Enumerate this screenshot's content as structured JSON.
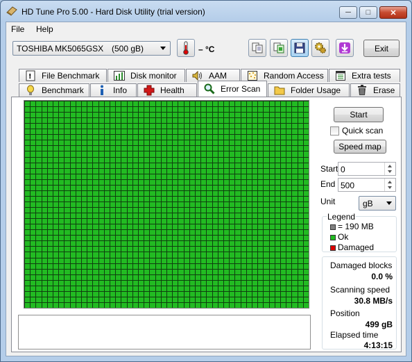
{
  "window": {
    "title": "HD Tune Pro 5.00 - Hard Disk Utility (trial version)",
    "controls": {
      "minimize": "─",
      "maximize": "□",
      "close": "✕"
    }
  },
  "menu": [
    {
      "label": "File"
    },
    {
      "label": "Help"
    }
  ],
  "toolbar": {
    "drive_name": "TOSHIBA MK5065GSX",
    "drive_size": "(500 gB)",
    "temperature": "– °C",
    "exit_label": "Exit"
  },
  "tabs_top": [
    {
      "label": "File Benchmark",
      "icon": "file-benchmark-icon"
    },
    {
      "label": "Disk monitor",
      "icon": "disk-monitor-icon"
    },
    {
      "label": "AAM",
      "icon": "speaker-icon"
    },
    {
      "label": "Random Access",
      "icon": "random-access-icon"
    },
    {
      "label": "Extra tests",
      "icon": "extra-tests-icon"
    }
  ],
  "tabs_bottom": [
    {
      "label": "Benchmark",
      "icon": "benchmark-icon"
    },
    {
      "label": "Info",
      "icon": "info-icon"
    },
    {
      "label": "Health",
      "icon": "health-cross-icon"
    },
    {
      "label": "Error Scan",
      "icon": "magnifier-icon",
      "selected": true
    },
    {
      "label": "Folder Usage",
      "icon": "folder-icon"
    },
    {
      "label": "Erase",
      "icon": "trash-icon"
    }
  ],
  "error_scan": {
    "start_button": "Start",
    "quick_scan_label": "Quick scan",
    "quick_scan_checked": false,
    "speed_map_button": "Speed map",
    "start_label": "Start",
    "start_value": "0",
    "end_label": "End",
    "end_value": "500",
    "unit_label": "Unit",
    "unit_value": "gB",
    "block_status": "ok",
    "colors": {
      "ok": "#22bb22",
      "damaged": "#dd0000",
      "block": "#808080",
      "grid": "#0f3f0f"
    }
  },
  "legend": {
    "title": "Legend",
    "items": [
      {
        "label": "= 190 MB",
        "color": "#808080"
      },
      {
        "label": "Ok",
        "color": "#22bb22"
      },
      {
        "label": "Damaged",
        "color": "#dd0000"
      }
    ]
  },
  "stats": {
    "damaged_blocks_label": "Damaged blocks",
    "damaged_blocks_value": "0.0 %",
    "scanning_speed_label": "Scanning speed",
    "scanning_speed_value": "30.8 MB/s",
    "position_label": "Position",
    "position_value": "499 gB",
    "elapsed_label": "Elapsed time",
    "elapsed_value": "4:13:15"
  }
}
